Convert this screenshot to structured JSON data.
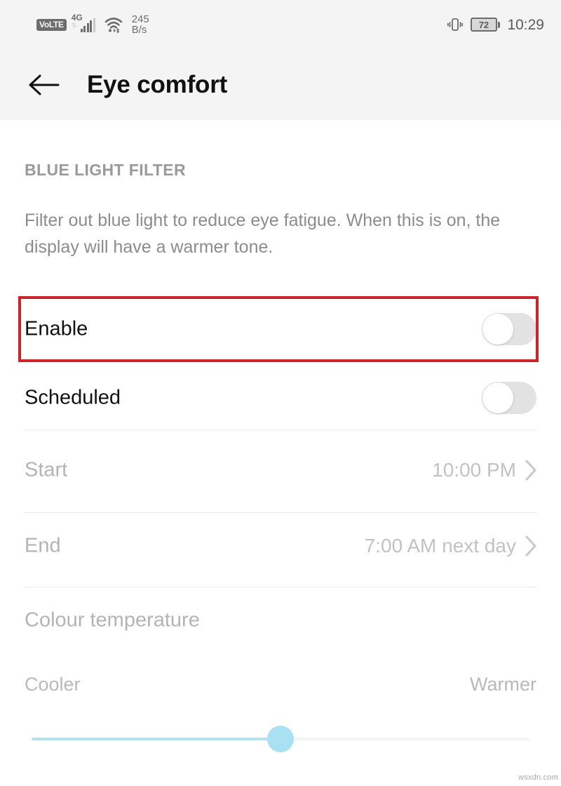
{
  "status_bar": {
    "volte_label": "VoLTE",
    "network_type": "4G",
    "network_speed_value": "245",
    "network_speed_unit": "B/s",
    "battery_level": "72",
    "clock": "10:29",
    "icons": {
      "signal": "signal-bars-icon",
      "wifi": "wifi-icon",
      "vibrate": "vibrate-icon",
      "battery": "battery-icon"
    }
  },
  "app_bar": {
    "back_icon": "back-arrow-icon",
    "title": "Eye comfort"
  },
  "section": {
    "title": "BLUE LIGHT FILTER",
    "description": "Filter out blue light to reduce eye fatigue. When this is on, the display will have a warmer tone."
  },
  "rows": {
    "enable": {
      "label": "Enable",
      "toggle_state": "off"
    },
    "scheduled": {
      "label": "Scheduled",
      "toggle_state": "off"
    },
    "start": {
      "label": "Start",
      "value": "10:00 PM",
      "chevron": "chevron-right-icon"
    },
    "end": {
      "label": "End",
      "value": "7:00 AM next day",
      "chevron": "chevron-right-icon"
    }
  },
  "colour_temperature": {
    "label": "Colour temperature",
    "cooler_label": "Cooler",
    "warmer_label": "Warmer",
    "slider_percent": 50
  },
  "annotation": {
    "target": "enable-row",
    "color": "#cc2229"
  },
  "watermark": "wsxdn.com"
}
